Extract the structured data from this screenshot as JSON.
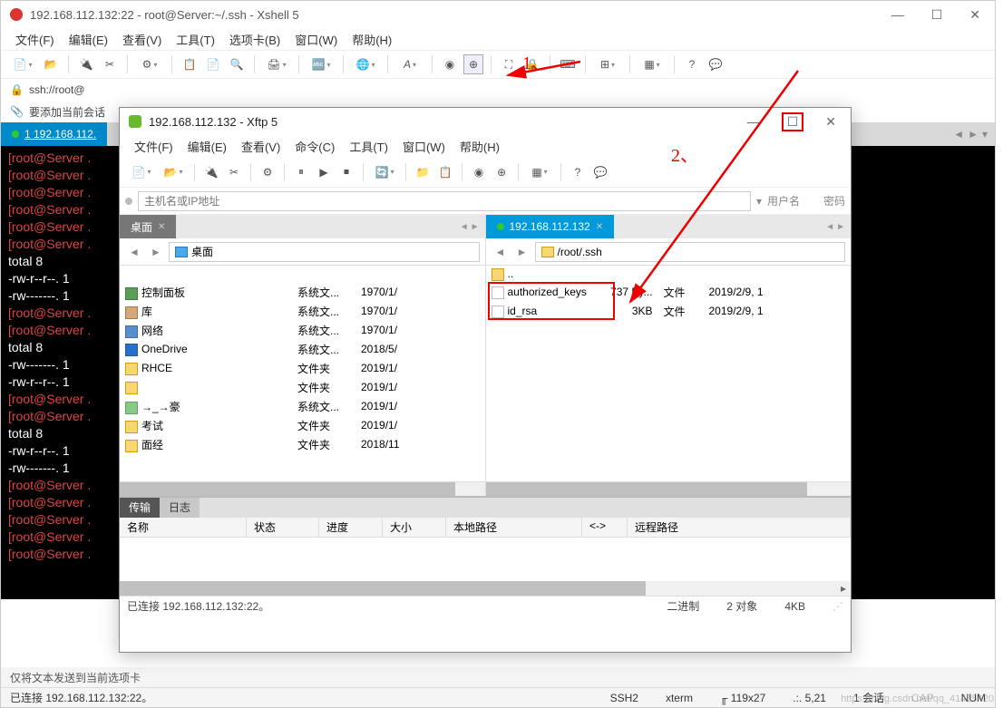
{
  "xshell": {
    "title": "192.168.112.132:22 - root@Server:~/.ssh - Xshell 5",
    "menu": [
      "文件(F)",
      "编辑(E)",
      "查看(V)",
      "工具(T)",
      "选项卡(B)",
      "窗口(W)",
      "帮助(H)"
    ],
    "address": "ssh://root@",
    "addlink": "要添加当前会话",
    "tab": "1 192.168.112.",
    "terminal_lines": [
      "[root@Server .",
      "[root@Server .",
      "[root@Server .",
      "[root@Server .",
      "[root@Server .",
      "[root@Server .",
      "total 8",
      "-rw-r--r--. 1",
      "-rw-------. 1",
      "[root@Server .",
      "[root@Server .",
      "total 8",
      "-rw-------. 1",
      "-rw-r--r--. 1",
      "[root@Server .",
      "[root@Server .",
      "total 8",
      "-rw-r--r--. 1",
      "-rw-------. 1",
      "[root@Server .",
      "[root@Server .",
      "[root@Server .",
      "[root@Server .",
      "[root@Server ."
    ],
    "bottomline": "仅将文本发送到当前选项卡",
    "status": {
      "connected": "已连接 192.168.112.132:22。",
      "ssh": "SSH2",
      "term": "xterm",
      "size": "119x27",
      "pos": "5,21",
      "session": "1 会话",
      "caps": "CAP",
      "num": "NUM"
    }
  },
  "xftp": {
    "title": "192.168.112.132   - Xftp 5",
    "menu": [
      "文件(F)",
      "编辑(E)",
      "查看(V)",
      "命令(C)",
      "工具(T)",
      "窗口(W)",
      "帮助(H)"
    ],
    "conn": {
      "host_placeholder": "主机名或IP地址",
      "user_placeholder": "用户名",
      "pass_placeholder": "密码"
    },
    "left": {
      "tab": "桌面",
      "path": "桌面",
      "rows": [
        {
          "name": "",
          "type": "",
          "date": "",
          "ico": "monitor"
        },
        {
          "name": "控制面板",
          "type": "系统文...",
          "date": "1970/1/",
          "ico": "ctrl"
        },
        {
          "name": "库",
          "type": "系统文...",
          "date": "1970/1/",
          "ico": "lib"
        },
        {
          "name": "网络",
          "type": "系统文...",
          "date": "1970/1/",
          "ico": "net"
        },
        {
          "name": "OneDrive",
          "type": "系统文...",
          "date": "2018/5/",
          "ico": "cloud"
        },
        {
          "name": "RHCE",
          "type": "文件夹",
          "date": "2019/1/",
          "ico": "folder"
        },
        {
          "name": "",
          "type": "文件夹",
          "date": "2019/1/",
          "ico": "folder"
        },
        {
          "name": "→_→豪",
          "type": "系统文...",
          "date": "2019/1/",
          "ico": "user"
        },
        {
          "name": "考试",
          "type": "文件夹",
          "date": "2019/1/",
          "ico": "folder"
        },
        {
          "name": "面经",
          "type": "文件夹",
          "date": "2018/11",
          "ico": "folder"
        }
      ],
      "col_name_w": 190,
      "col_type_w": 70,
      "col_date_w": 70
    },
    "right": {
      "tab": "192.168.112.132",
      "path": "/root/.ssh",
      "rows": [
        {
          "name": "..",
          "size": "",
          "type": "",
          "date": "",
          "ico": "folder"
        },
        {
          "name": "authorized_keys",
          "size": "737 By...",
          "type": "文件",
          "date": "2019/2/9, 1",
          "ico": "doc"
        },
        {
          "name": "id_rsa",
          "size": "3KB",
          "type": "文件",
          "date": "2019/2/9, 1",
          "ico": "doc"
        }
      ]
    },
    "bottom": {
      "tabs": [
        "传输",
        "日志"
      ],
      "headers": [
        "名称",
        "状态",
        "进度",
        "大小",
        "本地路径",
        "<->",
        "远程路径"
      ]
    },
    "status": {
      "connected": "已连接 192.168.112.132:22。",
      "mode": "二进制",
      "objects": "2 对象",
      "size": "4KB"
    }
  },
  "annotations": {
    "label1": "1、",
    "label2": "2、"
  },
  "watermark": "https://blog.csdn.net/qq_41455420"
}
